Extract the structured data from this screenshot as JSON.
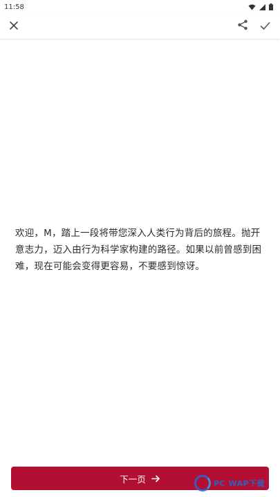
{
  "status_bar": {
    "time": "11:58",
    "icons": [
      "wifi-icon",
      "signal-icon",
      "battery-icon"
    ]
  },
  "toolbar": {
    "icons": [
      "close-icon",
      "share-icon",
      "check-icon"
    ]
  },
  "content": {
    "paragraph": "欢迎，M，踏上一段将带您深入人类行为背后的旅程。抛开意志力，迈入由行为科学家构建的路径。如果以前曾感到困难，现在可能会变得更容易，不要感到惊讶。"
  },
  "footer": {
    "next_label": "下一页",
    "next_icon": "arrow-right-icon",
    "button_color": "#b30f33"
  },
  "watermark": {
    "text": "PC WAP下载"
  }
}
